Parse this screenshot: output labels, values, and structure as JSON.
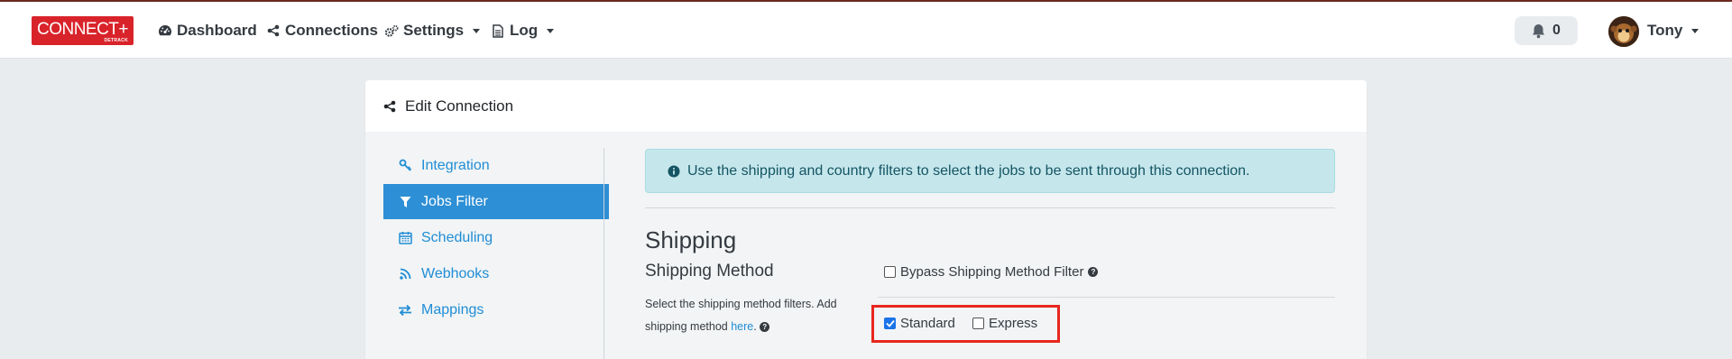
{
  "brand": {
    "logo_text": "CONNECT+",
    "logo_sub": "DETRACK"
  },
  "nav": {
    "items": [
      {
        "label": "Dashboard",
        "icon": "gauge-icon"
      },
      {
        "label": "Connections",
        "icon": "share-icon"
      },
      {
        "label": "Settings",
        "icon": "cogs-icon"
      },
      {
        "label": "Log",
        "icon": "file-icon"
      }
    ],
    "notifications_count": "0",
    "user_name": "Tony"
  },
  "card": {
    "title": "Edit Connection",
    "sidebar": [
      {
        "label": "Integration",
        "icon": "key-icon",
        "active": false
      },
      {
        "label": "Jobs Filter",
        "icon": "filter-icon",
        "active": true
      },
      {
        "label": "Scheduling",
        "icon": "calendar-icon",
        "active": false
      },
      {
        "label": "Webhooks",
        "icon": "rss-icon",
        "active": false
      },
      {
        "label": "Mappings",
        "icon": "exchange-icon",
        "active": false
      }
    ],
    "alert_text": "Use the shipping and country filters to select the jobs to be sent through this connection.",
    "section_title": "Shipping",
    "method_title": "Shipping Method",
    "bypass_label": "Bypass Shipping Method Filter",
    "help_text_1": "Select the shipping method filters. Add shipping method",
    "help_link": "here",
    "help_text_2": ".",
    "options": [
      {
        "label": "Standard",
        "checked": true
      },
      {
        "label": "Express",
        "checked": false
      }
    ]
  },
  "colors": {
    "accent": "#2d8fd5",
    "brand": "#d9232a",
    "highlight": "#e8261f"
  }
}
